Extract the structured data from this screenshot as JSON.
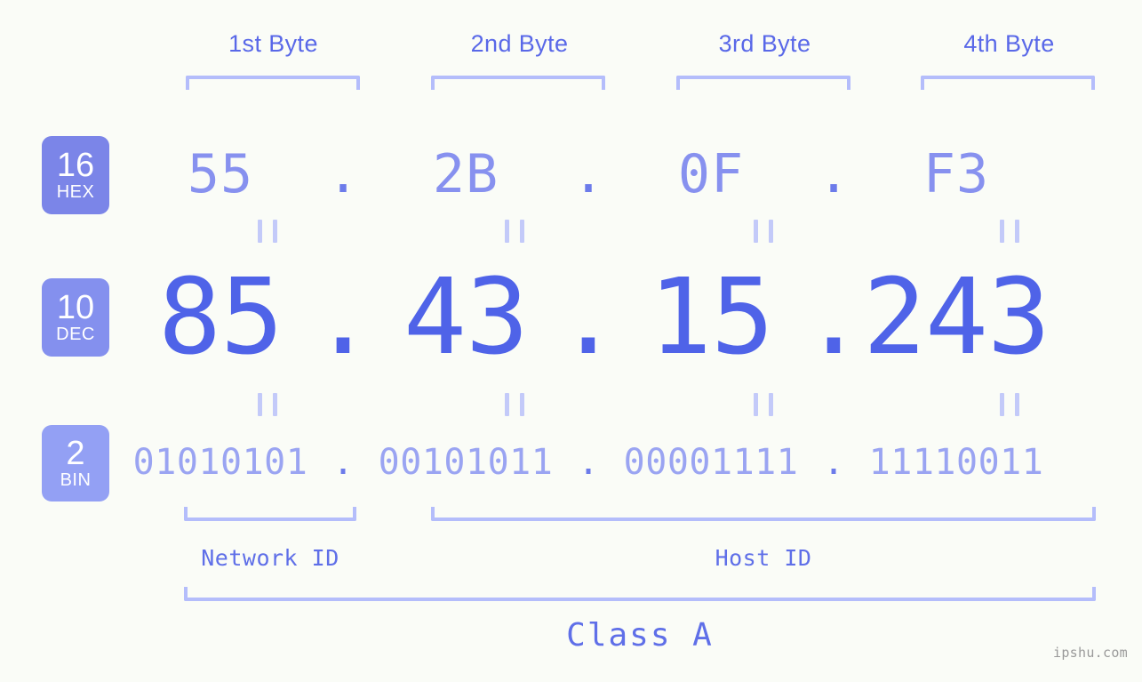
{
  "background_color": "#fafcf7",
  "accent_colors": {
    "bracket": "#b4bdfb",
    "header_text": "#5968e8",
    "hex_text": "#8791ef",
    "dec_text": "#4f63e8",
    "bin_text": "#9aa4f2",
    "badge_hex": "#7b85e8",
    "badge_dec": "#8490ee",
    "badge_bin": "#93a0f4",
    "equals": "#c3caf9",
    "watermark": "#9a9a9a"
  },
  "byte_headers": [
    {
      "label": "1st Byte"
    },
    {
      "label": "2nd Byte"
    },
    {
      "label": "3rd Byte"
    },
    {
      "label": "4th Byte"
    }
  ],
  "rows": {
    "hex": {
      "badge_number": "16",
      "badge_name": "HEX",
      "separator": ".",
      "values": [
        "55",
        "2B",
        "0F",
        "F3"
      ]
    },
    "dec": {
      "badge_number": "10",
      "badge_name": "DEC",
      "separator": ".",
      "values": [
        "85",
        "43",
        "15",
        "243"
      ]
    },
    "bin": {
      "badge_number": "2",
      "badge_name": "BIN",
      "separator": ".",
      "values": [
        "01010101",
        "00101011",
        "00001111",
        "11110011"
      ]
    }
  },
  "sections": [
    {
      "label": "Network ID"
    },
    {
      "label": "Host ID"
    }
  ],
  "class": {
    "label": "Class A"
  },
  "watermark": {
    "text": "ipshu.com"
  }
}
